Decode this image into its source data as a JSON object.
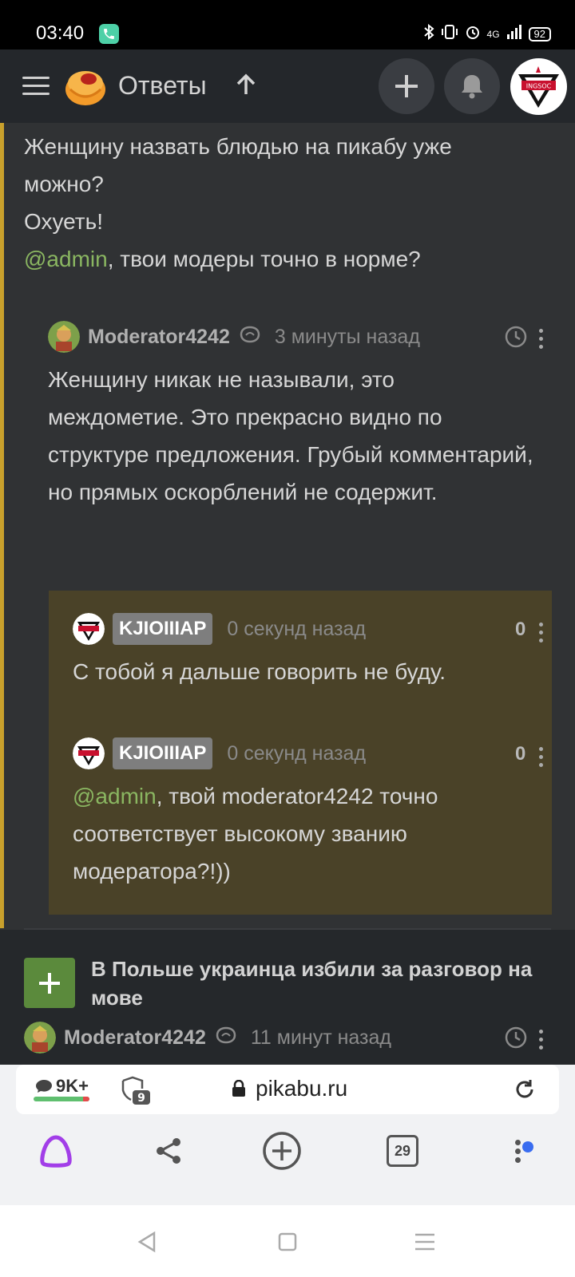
{
  "status_bar": {
    "time": "03:40",
    "network": "4G",
    "battery": "92"
  },
  "header": {
    "title": "Ответы"
  },
  "parent_comment": {
    "line1": "Женщину назвать блюдью на пикабу уже",
    "line2": "можно?",
    "line3": "Охуеть!",
    "mention": "@admin",
    "line4_rest": ", твои модеры точно в норме?"
  },
  "moderator_comment": {
    "username": "Moderator4242",
    "time": "3 минуты назад",
    "text": "Женщину никак не называли, это междометие. Это прекрасно видно по структуре предложения. Грубый комментарий, но прямых оскорблений не содержит."
  },
  "replies": [
    {
      "username": "KJIOIIIAP",
      "time": "0 секунд назад",
      "score": "0",
      "text": "С тобой я дальше говорить не буду."
    },
    {
      "username": "KJIOIIIAP",
      "time": "0 секунд назад",
      "score": "0",
      "mention": "@admin",
      "text": ", твой moderator4242 точно соответствует высокому званию модератора?!))"
    }
  ],
  "next_post": {
    "title": "В Польше украинца избили за разговор на мове",
    "username": "Moderator4242",
    "time": "11 минут назад"
  },
  "browser": {
    "comments_count": "9K+",
    "tabs_badge": "9",
    "url": "pikabu.ru",
    "tab_count": "29"
  },
  "colors": {
    "accent_green": "#5b8a3c",
    "mention": "#8ab661",
    "reply_bg": "#4a4228",
    "left_bar": "#c8a02c"
  }
}
